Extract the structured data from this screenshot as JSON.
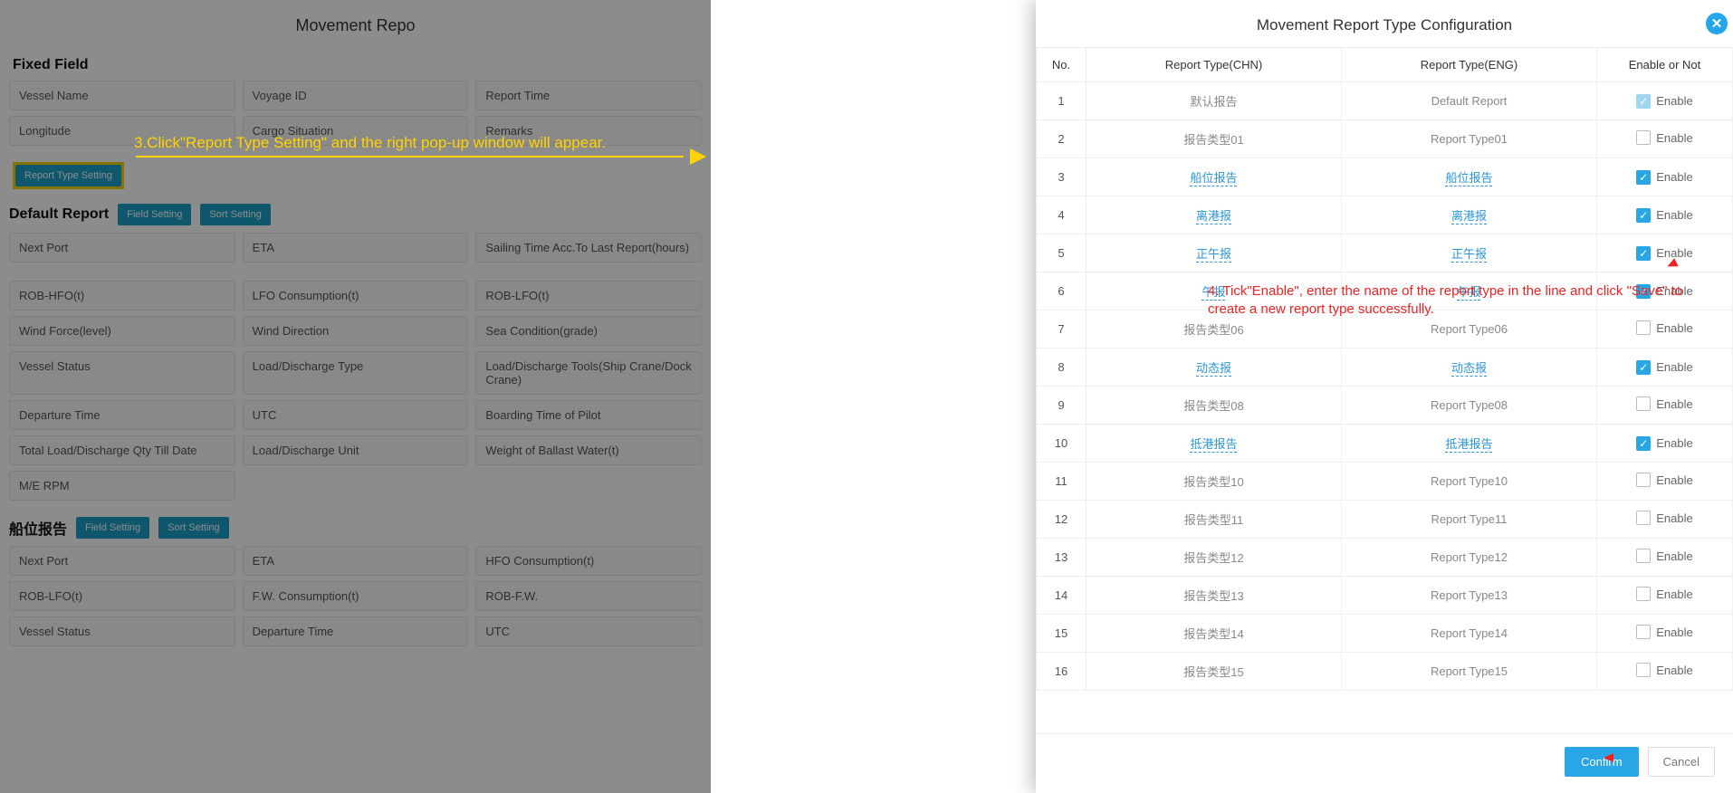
{
  "bg": {
    "title": "Movement Repo",
    "fixedField": {
      "title": "Fixed Field",
      "rows": [
        [
          "Vessel Name",
          "Voyage ID",
          "Report Time"
        ],
        [
          "Longitude",
          "Cargo Situation",
          "Remarks"
        ]
      ]
    },
    "reportTypeBtn": "Report Type Setting",
    "defaultReport": {
      "title": "Default Report",
      "fieldSettingBtn": "Field Setting",
      "sortSettingBtn": "Sort Setting",
      "rows": [
        [
          "Next Port",
          "ETA",
          "Sailing Time Acc.To Last Report(hours)"
        ],
        [
          "ROB-HFO(t)",
          "LFO Consumption(t)",
          "ROB-LFO(t)"
        ],
        [
          "Wind Force(level)",
          "Wind Direction",
          "Sea Condition(grade)"
        ],
        [
          "Vessel Status",
          "Load/Discharge Type",
          "Load/Discharge Tools(Ship Crane/Dock Crane)"
        ],
        [
          "Departure Time",
          "UTC",
          "Boarding Time of Pilot"
        ],
        [
          "Total Load/Discharge Qty Till Date",
          "Load/Discharge Unit",
          "Weight of Ballast Water(t)"
        ],
        [
          "M/E RPM"
        ]
      ]
    },
    "posReport": {
      "title": "船位报告",
      "fieldSettingBtn": "Field Setting",
      "sortSettingBtn": "Sort Setting",
      "rows": [
        [
          "Next Port",
          "ETA",
          "HFO Consumption(t)"
        ],
        [
          "ROB-LFO(t)",
          "F.W. Consumption(t)",
          "ROB-F.W."
        ],
        [
          "Vessel Status",
          "Departure Time",
          "UTC"
        ]
      ]
    }
  },
  "annot3": "3.Click\"Report Type Setting\" and the right pop-up window will appear.",
  "annot4": "4. Tick\"Enable\", enter the name of the report type in the line and click \"Save\" to create a new report type successfully.",
  "panel": {
    "title": "Movement Report Type Configuration",
    "headers": {
      "no": "No.",
      "chn": "Report Type(CHN)",
      "eng": "Report Type(ENG)",
      "enable": "Enable or Not"
    },
    "enableLabel": "Enable",
    "confirm": "Confirm",
    "cancel": "Cancel",
    "rows": [
      {
        "no": 1,
        "chn": "默认报告",
        "eng": "Default Report",
        "enabled": true,
        "locked": true,
        "editable": false
      },
      {
        "no": 2,
        "chn": "报告类型01",
        "eng": "Report Type01",
        "enabled": false,
        "editable": false
      },
      {
        "no": 3,
        "chn": "船位报告",
        "eng": "船位报告",
        "enabled": true,
        "editable": true
      },
      {
        "no": 4,
        "chn": "离港报",
        "eng": "离港报",
        "enabled": true,
        "editable": true
      },
      {
        "no": 5,
        "chn": "正午报",
        "eng": "正午报",
        "enabled": true,
        "editable": true
      },
      {
        "no": 6,
        "chn": "午报",
        "eng": "午报",
        "enabled": true,
        "editable": true
      },
      {
        "no": 7,
        "chn": "报告类型06",
        "eng": "Report Type06",
        "enabled": false,
        "editable": false
      },
      {
        "no": 8,
        "chn": "动态报",
        "eng": "动态报",
        "enabled": true,
        "editable": true
      },
      {
        "no": 9,
        "chn": "报告类型08",
        "eng": "Report Type08",
        "enabled": false,
        "editable": false
      },
      {
        "no": 10,
        "chn": "抵港报告",
        "eng": "抵港报告",
        "enabled": true,
        "editable": true
      },
      {
        "no": 11,
        "chn": "报告类型10",
        "eng": "Report Type10",
        "enabled": false,
        "editable": false
      },
      {
        "no": 12,
        "chn": "报告类型11",
        "eng": "Report Type11",
        "enabled": false,
        "editable": false
      },
      {
        "no": 13,
        "chn": "报告类型12",
        "eng": "Report Type12",
        "enabled": false,
        "editable": false
      },
      {
        "no": 14,
        "chn": "报告类型13",
        "eng": "Report Type13",
        "enabled": false,
        "editable": false
      },
      {
        "no": 15,
        "chn": "报告类型14",
        "eng": "Report Type14",
        "enabled": false,
        "editable": false
      },
      {
        "no": 16,
        "chn": "报告类型15",
        "eng": "Report Type15",
        "enabled": false,
        "editable": false
      }
    ]
  }
}
